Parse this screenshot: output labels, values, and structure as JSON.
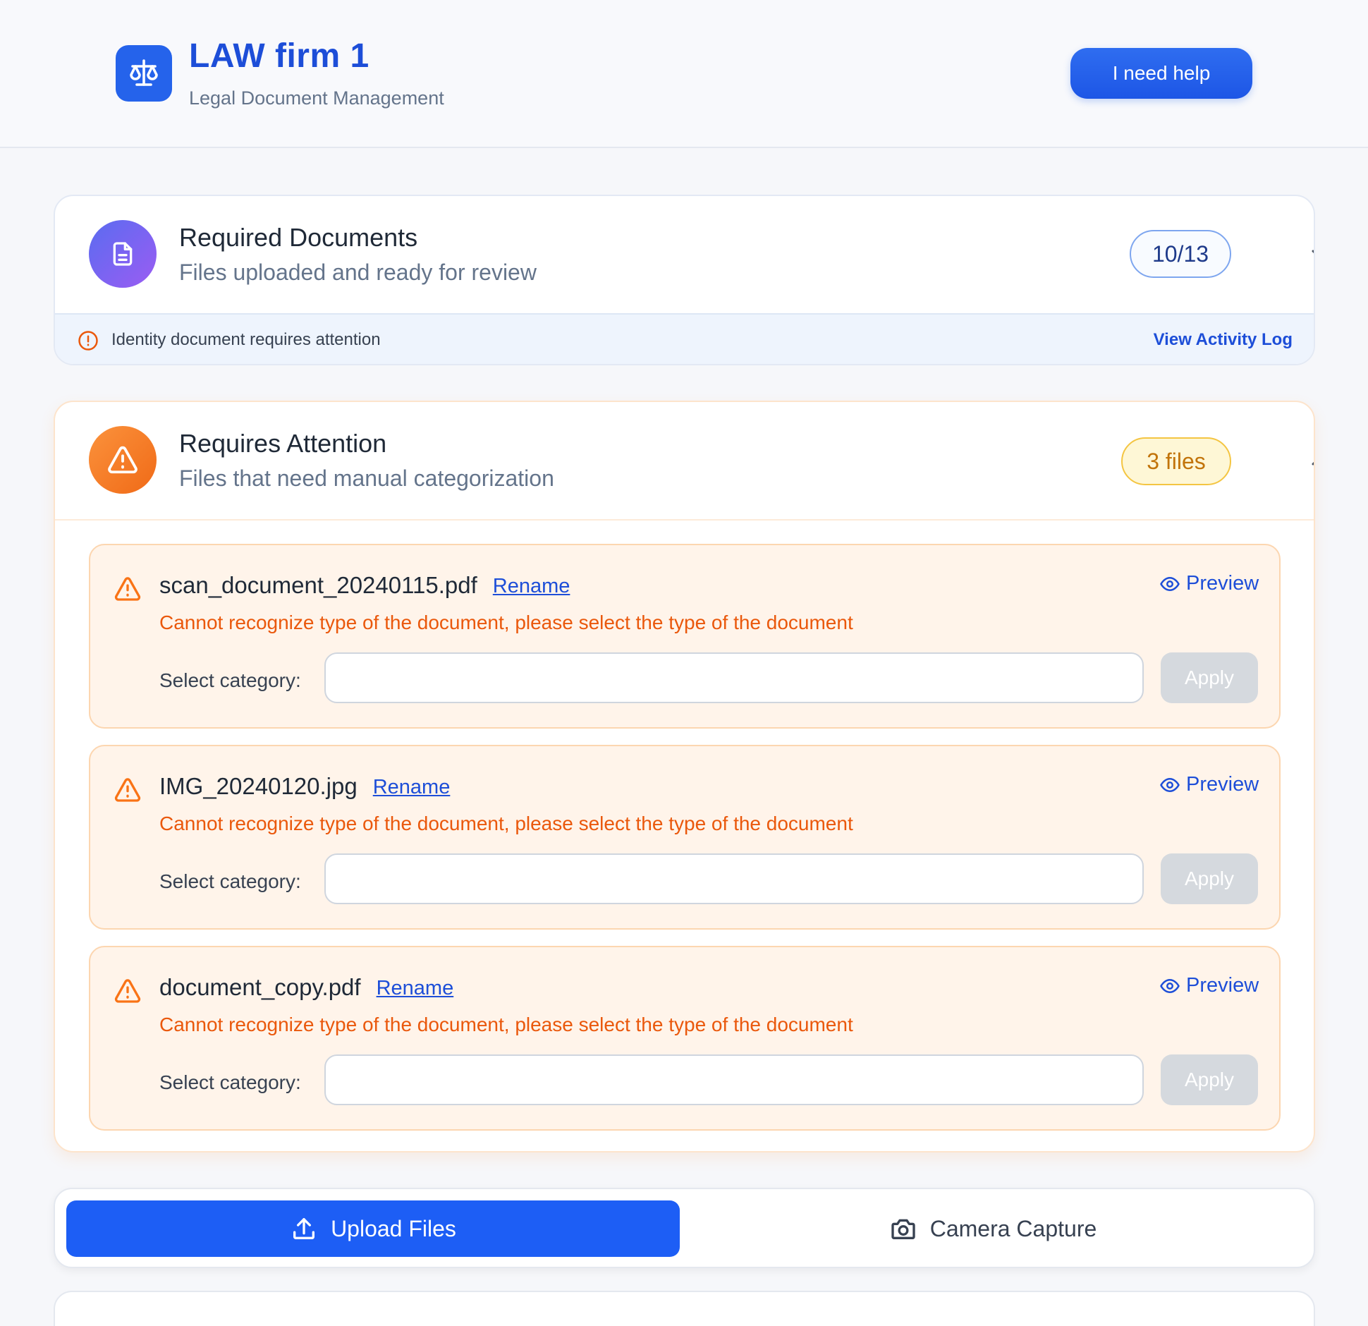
{
  "header": {
    "logo_icon": "scales-icon",
    "title": "LAW firm 1",
    "subtitle": "Legal Document Management",
    "help_label": "I need help"
  },
  "required": {
    "icon": "document-icon",
    "title": "Required Documents",
    "subtitle": "Files uploaded and ready for review",
    "count": "10/13",
    "alert_text": "Identity document requires attention",
    "activity_link": "View Activity Log"
  },
  "attention": {
    "icon": "warning-icon",
    "title": "Requires Attention",
    "subtitle": "Files that need manual categorization",
    "count": "3 files",
    "files": [
      {
        "name": "scan_document_20240115.pdf",
        "rename": "Rename",
        "error": "Cannot recognize type of the document, please select the type of the document",
        "preview": "Preview",
        "select_label": "Select category:",
        "select_value": "",
        "apply": "Apply"
      },
      {
        "name": "IMG_20240120.jpg",
        "rename": "Rename",
        "error": "Cannot recognize type of the document, please select the type of the document",
        "preview": "Preview",
        "select_label": "Select category:",
        "select_value": "",
        "apply": "Apply"
      },
      {
        "name": "document_copy.pdf",
        "rename": "Rename",
        "error": "Cannot recognize type of the document, please select the type of the document",
        "preview": "Preview",
        "select_label": "Select category:",
        "select_value": "",
        "apply": "Apply"
      }
    ]
  },
  "upload": {
    "upload_label": "Upload Files",
    "camera_label": "Camera Capture"
  },
  "colors": {
    "primary": "#1d5ef5",
    "brand_text": "#1d4ed8",
    "warning": "#ea580c",
    "badge_yellow": "#fef7d6"
  }
}
